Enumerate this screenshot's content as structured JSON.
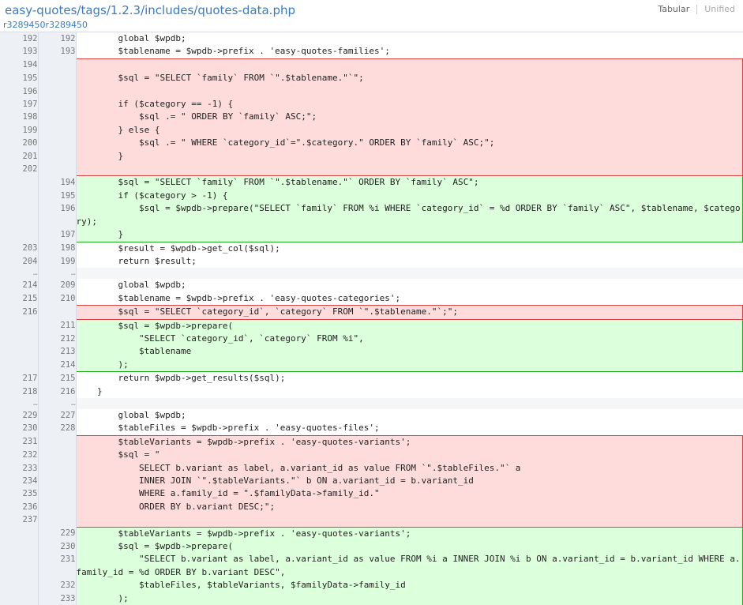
{
  "header": {
    "file_path": "easy-quotes/tags/1.2.3/includes/quotes-data.php",
    "revisions": "r3289450r3289450",
    "view_tabular": "Tabular",
    "view_unified": "Unified"
  },
  "diff_rows": [
    {
      "type": "ctx",
      "old": "192",
      "new": "192",
      "text": "        global $wpdb;"
    },
    {
      "type": "ctx",
      "old": "193",
      "new": "193",
      "text": "        $tablename = $wpdb->prefix . 'easy-quotes-families';"
    },
    {
      "type": "del",
      "old": "194",
      "new": "",
      "text": "",
      "first": true
    },
    {
      "type": "del",
      "old": "195",
      "new": "",
      "text": "        $sql = \"SELECT `family` FROM `\".$tablename.\"`\";"
    },
    {
      "type": "del",
      "old": "196",
      "new": "",
      "text": ""
    },
    {
      "type": "del",
      "old": "197",
      "new": "",
      "text": "        if ($category == -1) {"
    },
    {
      "type": "del",
      "old": "198",
      "new": "",
      "text": "            $sql .= \" ORDER BY `family` ASC;\";"
    },
    {
      "type": "del",
      "old": "199",
      "new": "",
      "text": "        } else {"
    },
    {
      "type": "del",
      "old": "200",
      "new": "",
      "text": "            $sql .= \" WHERE `category_id`=\".$category.\" ORDER BY `family` ASC;\";"
    },
    {
      "type": "del",
      "old": "201",
      "new": "",
      "text": "        }"
    },
    {
      "type": "del",
      "old": "202",
      "new": "",
      "text": "",
      "last": true
    },
    {
      "type": "add",
      "old": "",
      "new": "194",
      "text": "        $sql = \"SELECT `family` FROM `\".$tablename.\"` ORDER BY `family` ASC\";",
      "first": true
    },
    {
      "type": "add",
      "old": "",
      "new": "195",
      "text": "        if ($category > -1) {"
    },
    {
      "type": "add",
      "old": "",
      "new": "196",
      "text": "            $sql = $wpdb->prepare(\"SELECT `family` FROM %i WHERE `category_id` = %d ORDER BY `family` ASC\", $tablename, $category);"
    },
    {
      "type": "add",
      "old": "",
      "new": "197",
      "text": "        }",
      "last": true
    },
    {
      "type": "ctx",
      "old": "203",
      "new": "198",
      "text": "        $result = $wpdb->get_col($sql);"
    },
    {
      "type": "ctx",
      "old": "204",
      "new": "199",
      "text": "        return $result;"
    },
    {
      "type": "skip",
      "old": "…",
      "new": "…",
      "text": ""
    },
    {
      "type": "ctx",
      "old": "214",
      "new": "209",
      "text": "        global $wpdb;"
    },
    {
      "type": "ctx",
      "old": "215",
      "new": "210",
      "text": "        $tablename = $wpdb->prefix . 'easy-quotes-categories';"
    },
    {
      "type": "del",
      "old": "216",
      "new": "",
      "text": "        $sql = \"SELECT `category_id`, `category` FROM `\".$tablename.\"`;\";",
      "first": true,
      "last": true
    },
    {
      "type": "add",
      "old": "",
      "new": "211",
      "text": "        $sql = $wpdb->prepare(",
      "first": true
    },
    {
      "type": "add",
      "old": "",
      "new": "212",
      "text": "            \"SELECT `category_id`, `category` FROM %i\","
    },
    {
      "type": "add",
      "old": "",
      "new": "213",
      "text": "            $tablename"
    },
    {
      "type": "add",
      "old": "",
      "new": "214",
      "text": "        );",
      "last": true
    },
    {
      "type": "ctx",
      "old": "217",
      "new": "215",
      "text": "        return $wpdb->get_results($sql);"
    },
    {
      "type": "ctx",
      "old": "218",
      "new": "216",
      "text": "    }"
    },
    {
      "type": "skip",
      "old": "…",
      "new": "…",
      "text": ""
    },
    {
      "type": "ctx",
      "old": "229",
      "new": "227",
      "text": "        global $wpdb;"
    },
    {
      "type": "ctx",
      "old": "230",
      "new": "228",
      "text": "        $tableFiles = $wpdb->prefix . 'easy-quotes-files';"
    },
    {
      "type": "del",
      "old": "231",
      "new": "",
      "text": "        $tableVariants = $wpdb->prefix . 'easy-quotes-variants';",
      "first": true
    },
    {
      "type": "del",
      "old": "232",
      "new": "",
      "text": "        $sql = \""
    },
    {
      "type": "del",
      "old": "233",
      "new": "",
      "text": "            SELECT b.variant as label, a.variant_id as value FROM `\".$tableFiles.\"` a"
    },
    {
      "type": "del",
      "old": "234",
      "new": "",
      "text": "            INNER JOIN `\".$tableVariants.\"` b ON a.variant_id = b.variant_id"
    },
    {
      "type": "del",
      "old": "235",
      "new": "",
      "text": "            WHERE a.family_id = \".$familyData->family_id.\""
    },
    {
      "type": "del",
      "old": "236",
      "new": "",
      "text": "            ORDER BY b.variant DESC;\";"
    },
    {
      "type": "del",
      "old": "237",
      "new": "",
      "text": "",
      "last": true
    },
    {
      "type": "add",
      "old": "",
      "new": "229",
      "text": "        $tableVariants = $wpdb->prefix . 'easy-quotes-variants';",
      "first": true
    },
    {
      "type": "add",
      "old": "",
      "new": "230",
      "text": "        $sql = $wpdb->prepare("
    },
    {
      "type": "add",
      "old": "",
      "new": "231",
      "text": "            \"SELECT b.variant as label, a.variant_id as value FROM %i a INNER JOIN %i b ON a.variant_id = b.variant_id WHERE a.family_id = %d ORDER BY b.variant DESC\","
    },
    {
      "type": "add",
      "old": "",
      "new": "232",
      "text": "            $tableFiles, $tableVariants, $familyData->family_id"
    },
    {
      "type": "add",
      "old": "",
      "new": "233",
      "text": "        );"
    }
  ]
}
